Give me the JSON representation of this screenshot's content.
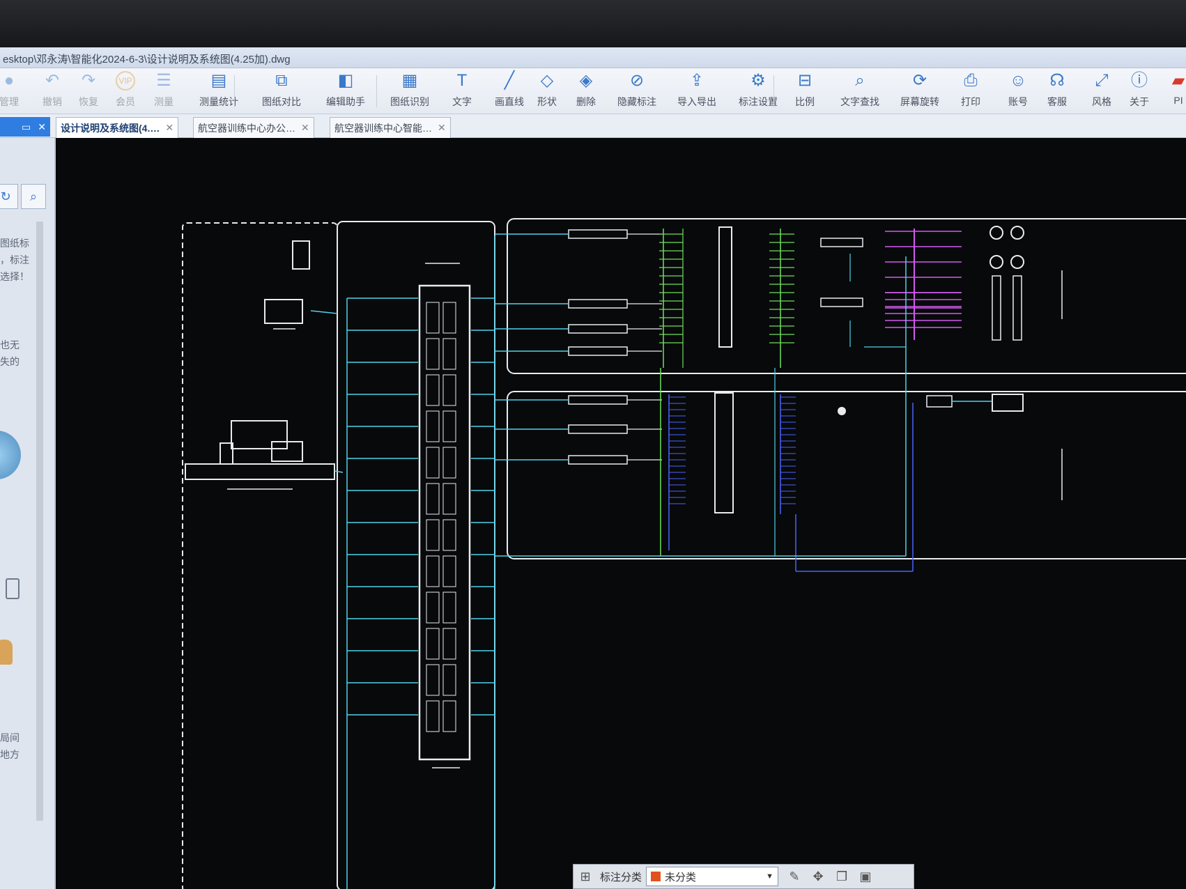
{
  "window": {
    "title": "esktop\\邓永涛\\智能化2024-6-3\\设计说明及系统图(4.25加).dwg"
  },
  "toolbar": {
    "items": [
      {
        "label": "管理",
        "icon": "folder-manage-icon"
      },
      {
        "label": "撤销",
        "icon": "undo-icon"
      },
      {
        "label": "恢复",
        "icon": "redo-icon"
      },
      {
        "label": "会员",
        "icon": "vip-icon",
        "glyph": "VIP"
      },
      {
        "label": "测量",
        "icon": "measure-icon"
      },
      {
        "label": "测量统计",
        "icon": "measure-stats-icon"
      },
      {
        "label": "图纸对比",
        "icon": "drawing-compare-icon"
      },
      {
        "label": "编辑助手",
        "icon": "edit-assistant-icon"
      },
      {
        "label": "图纸识别",
        "icon": "drawing-recognition-icon"
      },
      {
        "label": "文字",
        "icon": "text-icon"
      },
      {
        "label": "画直线",
        "icon": "line-icon"
      },
      {
        "label": "形状",
        "icon": "shape-icon"
      },
      {
        "label": "删除",
        "icon": "eraser-icon"
      },
      {
        "label": "隐藏标注",
        "icon": "hide-annotation-icon"
      },
      {
        "label": "导入导出",
        "icon": "import-export-icon"
      },
      {
        "label": "标注设置",
        "icon": "annotation-settings-icon"
      },
      {
        "label": "比例",
        "icon": "scale-icon"
      },
      {
        "label": "文字查找",
        "icon": "text-search-icon"
      },
      {
        "label": "屏幕旋转",
        "icon": "screen-rotate-icon"
      },
      {
        "label": "打印",
        "icon": "print-icon"
      },
      {
        "label": "账号",
        "icon": "account-icon"
      },
      {
        "label": "客服",
        "icon": "support-icon"
      },
      {
        "label": "风格",
        "icon": "style-icon"
      },
      {
        "label": "关于",
        "icon": "about-icon"
      },
      {
        "label": "PI",
        "icon": "pdf-icon"
      }
    ]
  },
  "tabs": [
    {
      "label": "设计说明及系统图(4.…",
      "active": true
    },
    {
      "label": "航空器训练中心办公…",
      "active": false
    },
    {
      "label": "航空器训练中心智能…",
      "active": false
    }
  ],
  "sidebar": {
    "snippets": [
      "图纸标",
      "，标注",
      "选择！",
      "也无",
      "失的",
      "局间",
      "地方"
    ]
  },
  "drawing": {
    "colors": {
      "cyan": "#4fd3ea",
      "white": "#e8ecef",
      "green": "#6ee25a",
      "magenta": "#d25bf0",
      "blue": "#4a63ff"
    }
  },
  "bottombar": {
    "category_label": "标注分类",
    "selected": "未分类",
    "selected_color": "#e0531f"
  }
}
